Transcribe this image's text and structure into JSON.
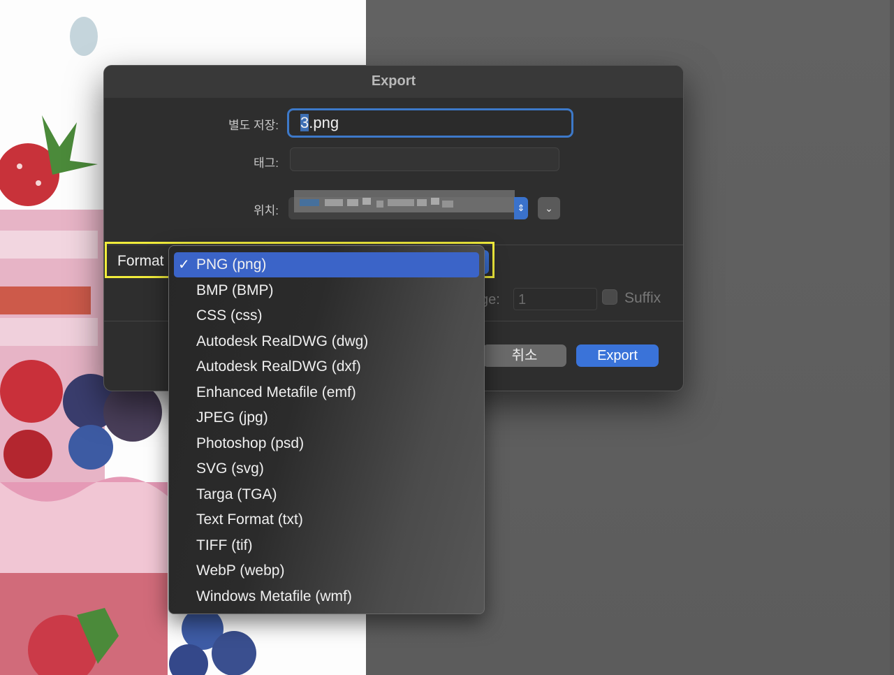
{
  "dialog": {
    "title": "Export",
    "save_as_label": "별도 저장:",
    "file_name_highlight": "3",
    "file_name_rest": ".png",
    "tags_label": "태그:",
    "tags_value": "",
    "location_label": "위치:",
    "format_label": "Format",
    "page_label_partial": "ge:",
    "page_value": "1",
    "suffix_label": "Suffix",
    "suffix_checked": false,
    "cancel_label": "취소",
    "export_label": "Export"
  },
  "format_menu": {
    "check_glyph": "✓",
    "selected_index": 0,
    "items": [
      "PNG (png)",
      "BMP (BMP)",
      "CSS (css)",
      "Autodesk RealDWG (dwg)",
      "Autodesk RealDWG (dxf)",
      "Enhanced Metafile (emf)",
      "JPEG (jpg)",
      "Photoshop (psd)",
      "SVG (svg)",
      "Targa (TGA)",
      "Text Format (txt)",
      "TIFF (tif)",
      "WebP (webp)",
      "Windows Metafile (wmf)"
    ]
  },
  "colors": {
    "accent_blue": "#3a73d9",
    "highlight_yellow": "#f1ec3c",
    "dialog_bg": "#2e2e2e"
  }
}
